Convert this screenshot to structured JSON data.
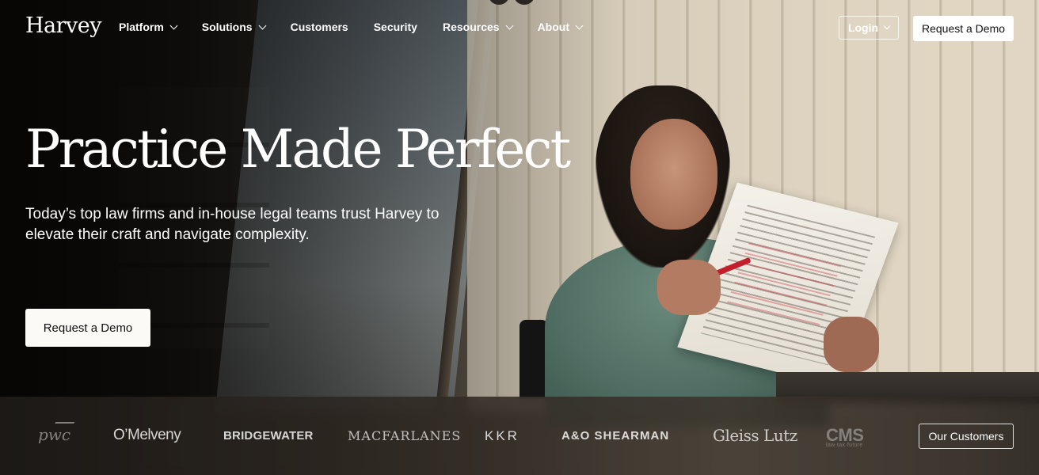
{
  "nav": {
    "logo": "Harvey",
    "links": [
      {
        "label": "Platform",
        "dropdown": true
      },
      {
        "label": "Solutions",
        "dropdown": true
      },
      {
        "label": "Customers",
        "dropdown": false
      },
      {
        "label": "Security",
        "dropdown": false
      },
      {
        "label": "Resources",
        "dropdown": true
      },
      {
        "label": "About",
        "dropdown": true
      }
    ],
    "login_label": "Login",
    "demo_label": "Request a Demo"
  },
  "hero": {
    "headline": "Practice Made Perfect",
    "subtitle": "Today’s top law firms and in-house legal teams trust Harvey to elevate their craft and navigate complexity.",
    "cta_label": "Request a Demo"
  },
  "clients": {
    "logos": [
      {
        "name": "pwc",
        "text": "pwc"
      },
      {
        "name": "omelveny",
        "text": "O’Melveny"
      },
      {
        "name": "bridgewater",
        "text": "BRIDGEWATER"
      },
      {
        "name": "macfarlanes",
        "text": "MACFARLANES"
      },
      {
        "name": "kkr",
        "text": "KKR"
      },
      {
        "name": "shearman",
        "text": "A&O SHEARMAN"
      },
      {
        "name": "gleiss",
        "text": "Gleiss Lutz"
      },
      {
        "name": "cms",
        "text": "CMS",
        "tagline": "law·tax·future"
      }
    ],
    "button_label": "Our Customers"
  },
  "colors": {
    "button_bg": "#ffffff",
    "button_text": "#111111",
    "text": "#ffffff"
  }
}
